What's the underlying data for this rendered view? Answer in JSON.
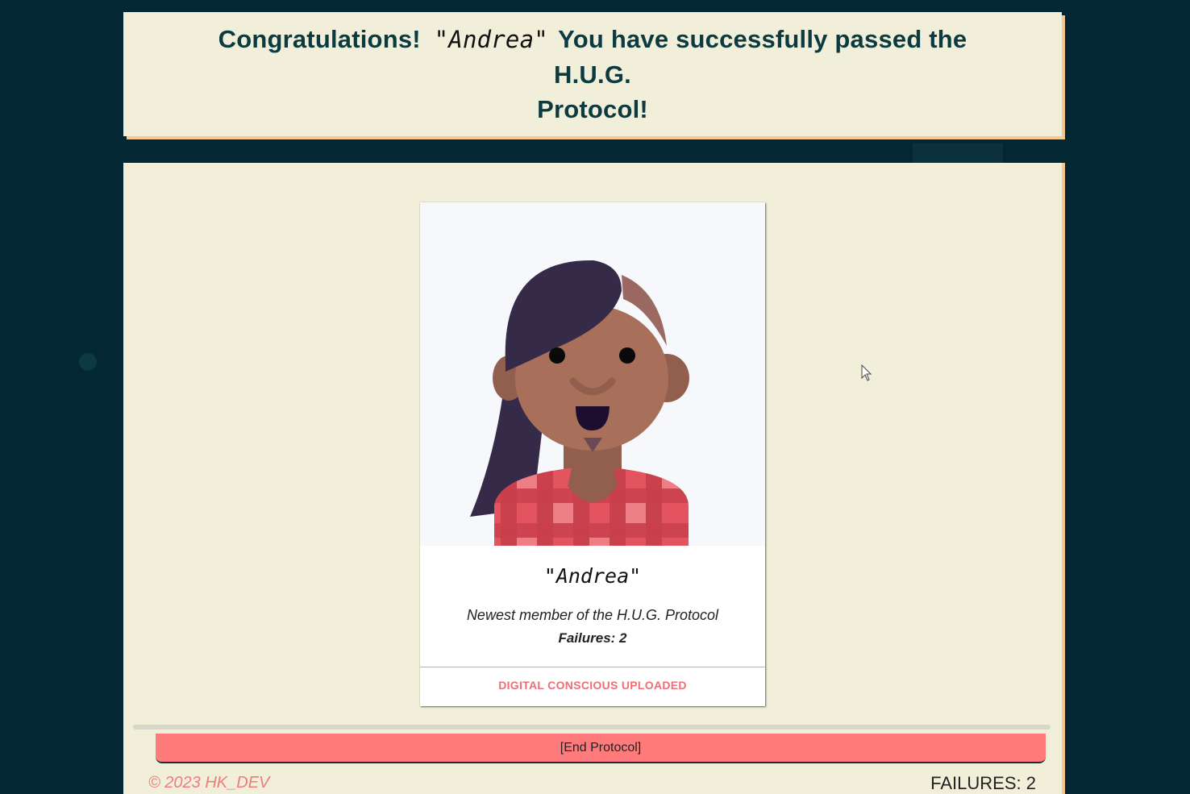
{
  "header": {
    "prefix": "Congratulations!",
    "name": "\"Andrea\"",
    "line1_suffix": "You have successfully passed the H.U.G.",
    "line2": "Protocol!"
  },
  "card": {
    "avatar_icon": "woman-avatar-illustration",
    "name": "\"Andrea\"",
    "description": "Newest member of the H.U.G. Protocol",
    "failures": "Failures: 2",
    "status": "DIGITAL CONSCIOUS UPLOADED"
  },
  "actions": {
    "end_label": "[End Protocol]"
  },
  "footer": {
    "copyright": "© 2023 HK_DEV",
    "failures": "FAILURES: 2"
  },
  "colors": {
    "background": "#032833",
    "panel": "#f1efd9",
    "panel_shadow": "#f7c98f",
    "title_text": "#0b3a40",
    "accent_red": "#ff7b7b",
    "status_red": "#ee6e76"
  }
}
